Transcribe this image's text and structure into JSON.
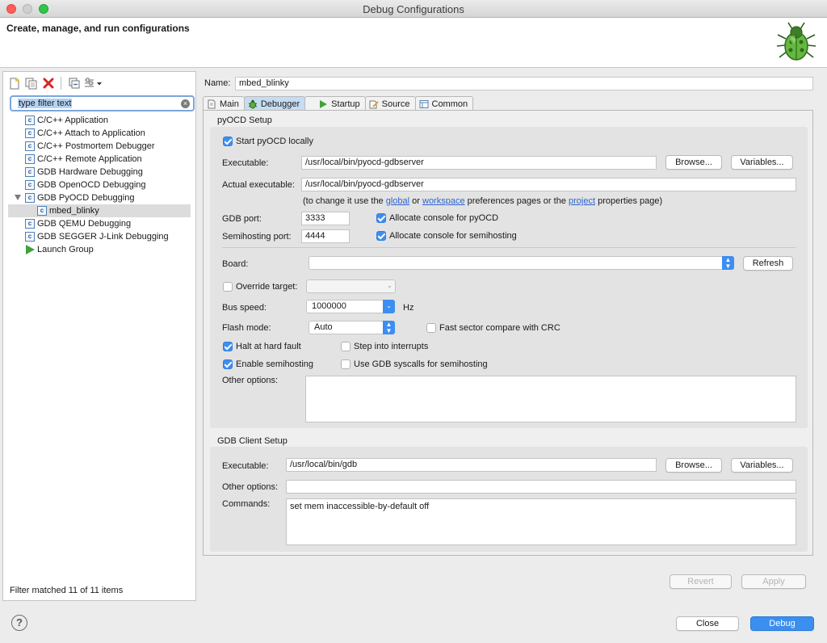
{
  "window": {
    "title": "Debug Configurations"
  },
  "header": {
    "title": "Create, manage, and run configurations",
    "icon": "bug-icon"
  },
  "left": {
    "filter_value": "type filter text",
    "toolbar_icons": [
      "new-config-icon",
      "duplicate-icon",
      "delete-icon",
      "collapse-all-icon",
      "filter-icon"
    ],
    "tree": [
      {
        "label": "C/C++ Application",
        "level": 0
      },
      {
        "label": "C/C++ Attach to Application",
        "level": 0
      },
      {
        "label": "C/C++ Postmortem Debugger",
        "level": 0
      },
      {
        "label": "C/C++ Remote Application",
        "level": 0
      },
      {
        "label": "GDB Hardware Debugging",
        "level": 0
      },
      {
        "label": "GDB OpenOCD Debugging",
        "level": 0
      },
      {
        "label": "GDB PyOCD Debugging",
        "level": 0,
        "expanded": true
      },
      {
        "label": "mbed_blinky",
        "level": 1,
        "selected": true
      },
      {
        "label": "GDB QEMU Debugging",
        "level": 0
      },
      {
        "label": "GDB SEGGER J-Link Debugging",
        "level": 0
      },
      {
        "label": "Launch Group",
        "level": 0
      }
    ],
    "status": "Filter matched 11 of 11 items"
  },
  "name": {
    "label": "Name:",
    "value": "mbed_blinky"
  },
  "tabs": [
    "Main",
    "Debugger",
    "Startup",
    "Source",
    "Common"
  ],
  "active_tab": "Debugger",
  "pyocd": {
    "section_title": "pyOCD Setup",
    "start_locally": {
      "label": "Start pyOCD locally",
      "checked": true
    },
    "executable": {
      "label": "Executable:",
      "value": "/usr/local/bin/pyocd-gdbserver"
    },
    "actual_executable": {
      "label": "Actual executable:",
      "value": "/usr/local/bin/pyocd-gdbserver"
    },
    "note": {
      "prefix": "(to change it use the ",
      "global": "global",
      "or": " or ",
      "workspace": "workspace",
      "mid": " preferences pages or the ",
      "project": "project",
      "suffix": " properties page)"
    },
    "gdb_port": {
      "label": "GDB port:",
      "value": "3333"
    },
    "semihosting_port": {
      "label": "Semihosting port:",
      "value": "4444"
    },
    "alloc_console_pyocd": {
      "label": "Allocate console for pyOCD",
      "checked": true
    },
    "alloc_console_semihosting": {
      "label": "Allocate console for semihosting",
      "checked": true
    },
    "board": {
      "label": "Board:",
      "value": ""
    },
    "override_target": {
      "label": "Override target:",
      "checked": false,
      "value": ""
    },
    "bus_speed": {
      "label": "Bus speed:",
      "value": "1000000",
      "unit": "Hz"
    },
    "flash_mode": {
      "label": "Flash mode:",
      "value": "Auto"
    },
    "fast_sector": {
      "label": "Fast sector compare with CRC",
      "checked": false
    },
    "halt_hard_fault": {
      "label": "Halt at hard fault",
      "checked": true
    },
    "step_interrupts": {
      "label": "Step into interrupts",
      "checked": false
    },
    "enable_semihosting": {
      "label": "Enable semihosting",
      "checked": true
    },
    "gdb_syscalls": {
      "label": "Use GDB syscalls for semihosting",
      "checked": false
    },
    "other_options": {
      "label": "Other options:",
      "value": ""
    }
  },
  "gdb_client": {
    "section_title": "GDB Client Setup",
    "executable": {
      "label": "Executable:",
      "value": "/usr/local/bin/gdb"
    },
    "other_options": {
      "label": "Other options:",
      "value": ""
    },
    "commands": {
      "label": "Commands:",
      "value": "set mem inaccessible-by-default off"
    }
  },
  "buttons": {
    "browse": "Browse...",
    "variables": "Variables...",
    "refresh": "Refresh",
    "revert": "Revert",
    "apply": "Apply",
    "close": "Close",
    "debug": "Debug"
  },
  "colors": {
    "accent": "#3b8ff0",
    "link": "#2a63d4",
    "tree_icon": "#4f7fb5",
    "launch_group": "#3fa33a"
  }
}
